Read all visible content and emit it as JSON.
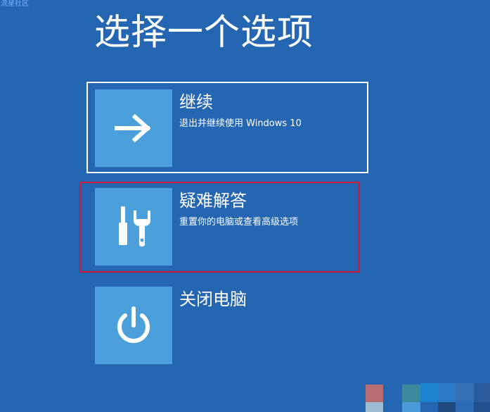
{
  "watermark": "流星社区",
  "page_title": "选择一个选项",
  "options": [
    {
      "title": "继续",
      "description": "退出并继续使用 Windows 10",
      "icon": "arrow-right-icon"
    },
    {
      "title": "疑难解答",
      "description": "重置你的电脑或查看高级选项",
      "icon": "tools-icon"
    },
    {
      "title": "关闭电脑",
      "description": "",
      "icon": "power-icon"
    }
  ],
  "colors": {
    "background": "#2566b3",
    "tile": "#4ba0dc",
    "focus_border": "#ffffff",
    "annotation_border": "#d11a35"
  }
}
